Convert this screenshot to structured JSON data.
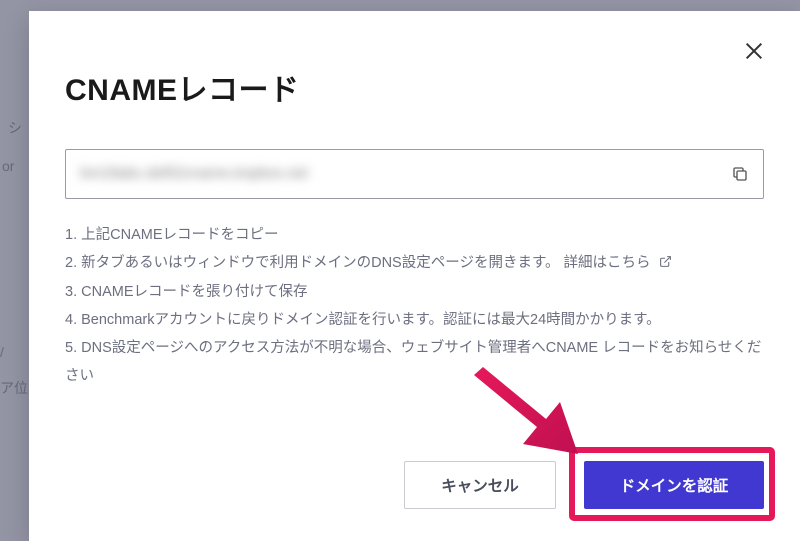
{
  "modal": {
    "title": "CNAMEレコード",
    "cname_value": "bm18abc.def02cname.tmpbox.net",
    "instructions": {
      "item1": "1. 上記CNAMEレコードをコピー",
      "item2_prefix": "2. 新タブあるいはウィンドウで利用ドメインのDNS設定ページを開きます。",
      "item2_link": "詳細はこちら",
      "item3": "3. CNAMEレコードを張り付けて保存",
      "item4": "4. Benchmarkアカウントに戻りドメイン認証を行います。認証には最大24時間かかります。",
      "item5": "5. DNS設定ページへのアクセス方法が不明な場合、ウェブサイト管理者へCNAME レコードをお知らせください"
    },
    "buttons": {
      "cancel": "キャンセル",
      "verify": "ドメインを認証"
    }
  },
  "background": {
    "t1": "シ",
    "t2": "or",
    "t3": "/",
    "t4": "ア位"
  }
}
